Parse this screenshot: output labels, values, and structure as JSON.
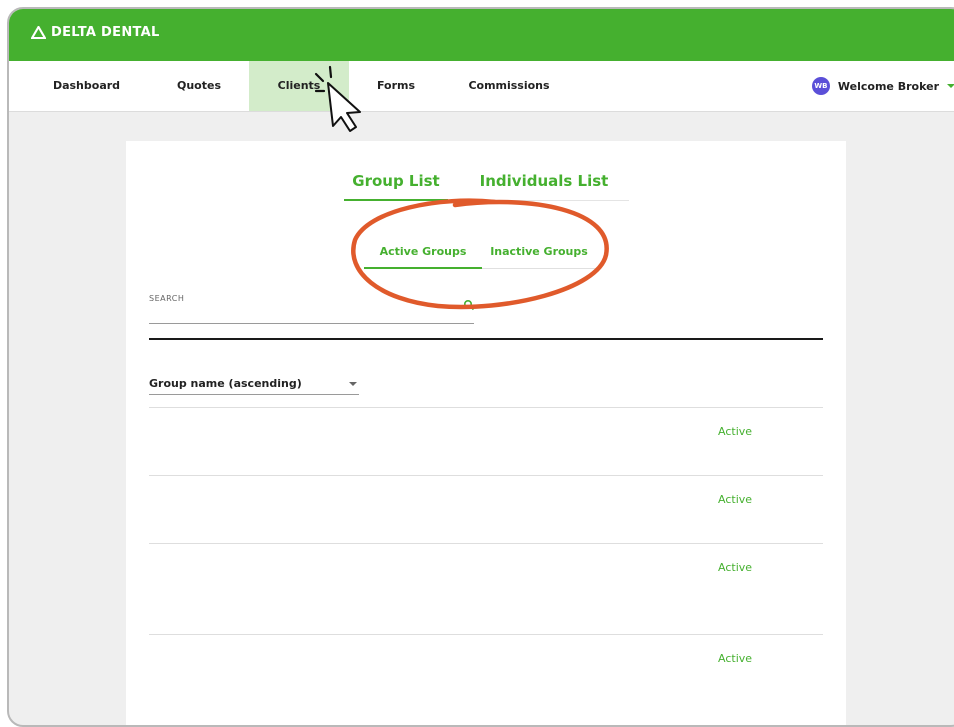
{
  "brand": {
    "name": "DELTA DENTAL",
    "color": "#45b02f"
  },
  "nav": {
    "items": [
      {
        "label": "Dashboard"
      },
      {
        "label": "Quotes"
      },
      {
        "label": "Clients",
        "active": true
      },
      {
        "label": "Forms"
      },
      {
        "label": "Commissions"
      }
    ],
    "user": {
      "initials": "WB",
      "greeting": "Welcome Broker"
    }
  },
  "tabs": {
    "primary": [
      {
        "label": "Group List",
        "active": true
      },
      {
        "label": "Individuals List"
      }
    ],
    "secondary": [
      {
        "label": "Active Groups",
        "active": true
      },
      {
        "label": "Inactive Groups"
      }
    ]
  },
  "search": {
    "label": "SEARCH",
    "value": ""
  },
  "sort": {
    "selected": "Group name (ascending)"
  },
  "rows": [
    {
      "status": "Active"
    },
    {
      "status": "Active"
    },
    {
      "status": "Active"
    },
    {
      "status": "Active"
    }
  ],
  "colors": {
    "accent": "#45b02f",
    "annotation": "#e05a2b",
    "avatar": "#5b4fd8"
  }
}
